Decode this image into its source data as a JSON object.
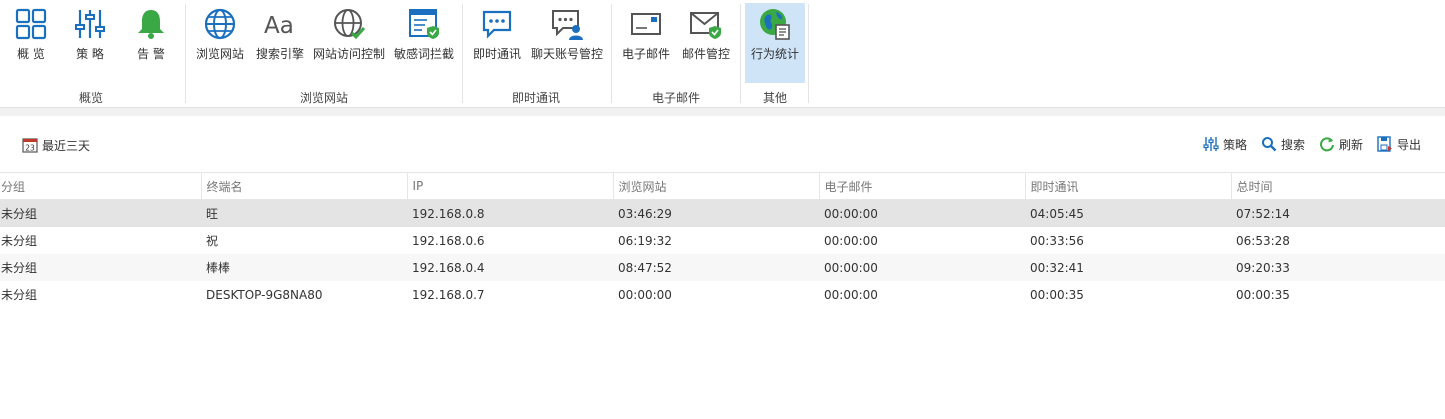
{
  "ribbon": {
    "groups": [
      {
        "label": "概览",
        "buttons": [
          "概 览",
          "策 略",
          "告 警"
        ]
      },
      {
        "label": "浏览网站",
        "buttons": [
          "浏览网站",
          "搜索引擎",
          "网站访问控制",
          "敏感词拦截"
        ]
      },
      {
        "label": "即时通讯",
        "buttons": [
          "即时通讯",
          "聊天账号管控"
        ]
      },
      {
        "label": "电子邮件",
        "buttons": [
          "电子邮件",
          "邮件管控"
        ]
      },
      {
        "label": "其他",
        "buttons": [
          "行为统计"
        ]
      }
    ],
    "active_button": "行为统计"
  },
  "toolbar": {
    "date_range": "最近三天",
    "calendar_day": "23",
    "actions": [
      "策略",
      "搜索",
      "刷新",
      "导出"
    ]
  },
  "table": {
    "columns": [
      "分组",
      "终端名",
      "IP",
      "浏览网站",
      "电子邮件",
      "即时通讯",
      "总时间"
    ],
    "rows": [
      [
        "未分组",
        "旺",
        "192.168.0.8",
        "03:46:29",
        "00:00:00",
        "04:05:45",
        "07:52:14"
      ],
      [
        "未分组",
        "祝",
        "192.168.0.6",
        "06:19:32",
        "00:00:00",
        "00:33:56",
        "06:53:28"
      ],
      [
        "未分组",
        "棒棒",
        "192.168.0.4",
        "08:47:52",
        "00:00:00",
        "00:32:41",
        "09:20:33"
      ],
      [
        "未分组",
        "DESKTOP-9G8NA80",
        "192.168.0.7",
        "00:00:00",
        "00:00:00",
        "00:00:35",
        "00:00:35"
      ]
    ],
    "selected_row": 0
  },
  "colors": {
    "icon_blue": "#1b6fbf",
    "icon_green": "#3aa845",
    "active_bg": "#cfe4f7",
    "selected_row_bg": "#e4e4e4"
  }
}
